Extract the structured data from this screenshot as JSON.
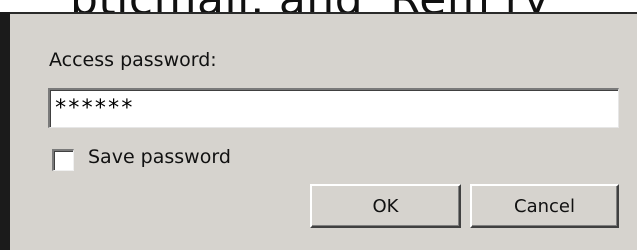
{
  "background": {
    "partial_text": "pticmail, and 'Rem ry"
  },
  "dialog": {
    "prompt_label": "Access password:",
    "password_value": "******",
    "save_password_label": "Save password",
    "save_password_checked": false,
    "ok_label": "OK",
    "cancel_label": "Cancel"
  },
  "colors": {
    "dialog_background": "#d6d3ce",
    "field_background": "#ffffff",
    "text": "#111111"
  }
}
